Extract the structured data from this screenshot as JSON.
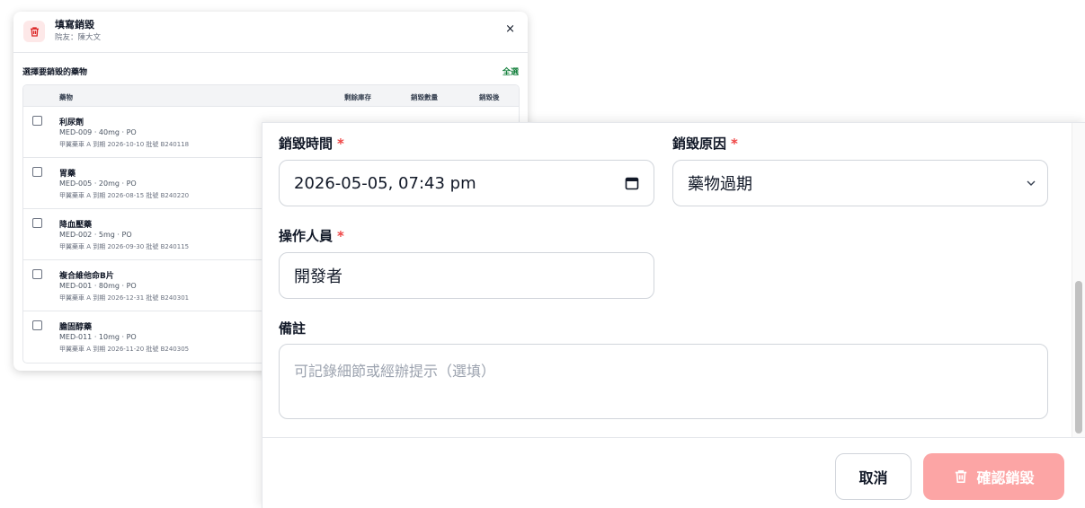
{
  "bg_dialog": {
    "title": "填寫銷毀",
    "subtitle": "院友：陳大文",
    "close": "×",
    "section_title": "選擇要銷毀的藥物",
    "select_all": "全選",
    "columns": [
      "藥物",
      "剩餘庫存",
      "銷毀數量",
      "銷毀後"
    ],
    "rows": [
      {
        "name": "利尿劑",
        "meta": "MED-009 · 40mg · PO",
        "batch": "甲翼藥車 A  到期 2026-10-10  批號 B240118"
      },
      {
        "name": "胃藥",
        "meta": "MED-005 · 20mg · PO",
        "batch": "甲翼藥車 A  到期 2026-08-15  批號 B240220"
      },
      {
        "name": "降血壓藥",
        "meta": "MED-002 · 5mg · PO",
        "batch": "甲翼藥車 A  到期 2026-09-30  批號 B240115"
      },
      {
        "name": "複合維他命B片",
        "meta": "MED-001 · 80mg · PO",
        "batch": "甲翼藥車 A  到期 2026-12-31  批號 B240301"
      },
      {
        "name": "膽固醇藥",
        "meta": "MED-011 · 10mg · PO",
        "batch": "甲翼藥車 A  到期 2026-11-20  批號 B240305"
      }
    ]
  },
  "form": {
    "datetime_label": "銷毀時間",
    "datetime_value": "2026-05-05, 07:43 pm",
    "reason_label": "銷毀原因",
    "reason_value": "藥物過期",
    "operator_label": "操作人員",
    "operator_value": "開發者",
    "notes_label": "備註",
    "notes_placeholder": "可記錄細節或經辦提示（選填）",
    "required_mark": "*"
  },
  "footer": {
    "cancel_label": "取消",
    "confirm_label": "確認銷毀"
  },
  "icons": {
    "trash": "trash-icon",
    "calendar": "calendar-icon",
    "chevron": "chevron-down-icon",
    "close": "close-icon"
  },
  "colors": {
    "required": "#ef4444",
    "confirm_bg": "#fca5a5",
    "select_all": "#15803d",
    "trash_icon": "#dc2626"
  }
}
